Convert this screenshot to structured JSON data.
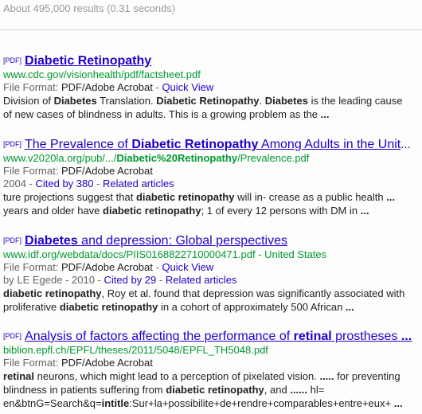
{
  "stats": "About 495,000 results (0.31 seconds)",
  "colors": {
    "title_link": "#2200cc",
    "url": "#009933",
    "stats": "#999999",
    "meta": "#666666",
    "text": "#222222"
  },
  "results": [
    {
      "tag": "[PDF]",
      "title_parts": [
        {
          "text": "Diabetic Retinopathy",
          "bold": true
        }
      ],
      "title_ellipsis": "",
      "url_parts": [
        {
          "text": "www.cdc.gov/visionhealth/pdf/factsheet.pdf",
          "bold": false
        }
      ],
      "file_format_label": "File Format: ",
      "file_format": "PDF/Adobe Acrobat",
      "quick_view": "Quick View",
      "citation_line": null,
      "snippet_lines": [
        [
          {
            "text": "Division of ",
            "bold": false
          },
          {
            "text": "Diabetes",
            "bold": true
          },
          {
            "text": " Translation. ",
            "bold": false
          },
          {
            "text": "Diabetic Retinopathy",
            "bold": true
          },
          {
            "text": ". ",
            "bold": false
          },
          {
            "text": "Diabetes",
            "bold": true
          },
          {
            "text": " is the leading cause",
            "bold": false
          }
        ],
        [
          {
            "text": "of new cases of blindness in adults. This is a growing problem as the ",
            "bold": false
          },
          {
            "text": "...",
            "bold": true
          }
        ]
      ]
    },
    {
      "tag": "[PDF]",
      "title_parts": [
        {
          "text": "The Prevalence of ",
          "bold": false
        },
        {
          "text": "Diabetic Retinopathy",
          "bold": true
        },
        {
          "text": " Among Adults in the Unit",
          "bold": false
        }
      ],
      "title_ellipsis": "...",
      "url_parts": [
        {
          "text": "www.v2020la.org/pub/.../",
          "bold": false
        },
        {
          "text": "Diabetic%20Retinopathy",
          "bold": true
        },
        {
          "text": "/Prevalence.pdf",
          "bold": false
        }
      ],
      "file_format_label": "File Format: ",
      "file_format": "PDF/Adobe Acrobat",
      "quick_view": null,
      "citation_line": {
        "author": "",
        "year": "2004",
        "cited_by": "Cited by 380",
        "related": "Related articles"
      },
      "snippet_lines": [
        [
          {
            "text": "ture projections suggest that ",
            "bold": false
          },
          {
            "text": "diabetic retinopathy",
            "bold": true
          },
          {
            "text": " will in- crease as a public health ",
            "bold": false
          },
          {
            "text": "...",
            "bold": true
          }
        ],
        [
          {
            "text": "years and older have ",
            "bold": false
          },
          {
            "text": "diabetic retinopathy",
            "bold": true
          },
          {
            "text": "; 1 of every 12 persons with DM in ",
            "bold": false
          },
          {
            "text": "...",
            "bold": true
          }
        ]
      ]
    },
    {
      "tag": "[PDF]",
      "title_parts": [
        {
          "text": "Diabetes",
          "bold": true
        },
        {
          "text": " and depression: Global perspectives",
          "bold": false
        }
      ],
      "title_ellipsis": "",
      "url_parts": [
        {
          "text": "www.idf.org/webdata/docs/PIIS0168822710000471.pdf - United States",
          "bold": false
        }
      ],
      "file_format_label": "File Format: ",
      "file_format": "PDF/Adobe Acrobat",
      "quick_view": "Quick View",
      "citation_line": {
        "author": "by LE Egede",
        "year": "2010",
        "cited_by": "Cited by 29",
        "related": "Related articles"
      },
      "snippet_lines": [
        [
          {
            "text": "diabetic retinopathy",
            "bold": true
          },
          {
            "text": ", Roy et al. found that depression was significantly associated with",
            "bold": false
          }
        ],
        [
          {
            "text": "proliferative ",
            "bold": false
          },
          {
            "text": "diabetic retinopathy",
            "bold": true
          },
          {
            "text": " in a cohort of approximately 500 African ",
            "bold": false
          },
          {
            "text": "...",
            "bold": true
          }
        ]
      ]
    },
    {
      "tag": "[PDF]",
      "title_parts": [
        {
          "text": "Analysis of factors affecting the performance of ",
          "bold": false
        },
        {
          "text": "retinal",
          "bold": true
        },
        {
          "text": " prostheses ",
          "bold": false
        },
        {
          "text": "...",
          "bold": true
        }
      ],
      "title_ellipsis": "",
      "url_parts": [
        {
          "text": "biblion.epfl.ch/EPFL/theses/2011/5048/EPFL_TH5048.pdf",
          "bold": false
        }
      ],
      "file_format_label": "File Format: ",
      "file_format": "PDF/Adobe Acrobat",
      "quick_view": null,
      "citation_line": null,
      "snippet_lines": [
        [
          {
            "text": "retinal",
            "bold": true
          },
          {
            "text": " neurons, which might lead to a perception of pixelated vision. ",
            "bold": false
          },
          {
            "text": ".....",
            "bold": true
          },
          {
            "text": " for preventing",
            "bold": false
          }
        ],
        [
          {
            "text": "blindness in patients suffering from ",
            "bold": false
          },
          {
            "text": "diabetic retinopathy",
            "bold": true
          },
          {
            "text": ", and ",
            "bold": false
          },
          {
            "text": "......",
            "bold": true
          },
          {
            "text": " hl=",
            "bold": false
          }
        ],
        [
          {
            "text": "en&btnG=Search&q=",
            "bold": false
          },
          {
            "text": "intitle",
            "bold": true
          },
          {
            "text": ":Sur+la+possibilite+de+rendre+comparables+entre+eux+ ",
            "bold": false
          },
          {
            "text": "...",
            "bold": true
          }
        ]
      ]
    }
  ]
}
